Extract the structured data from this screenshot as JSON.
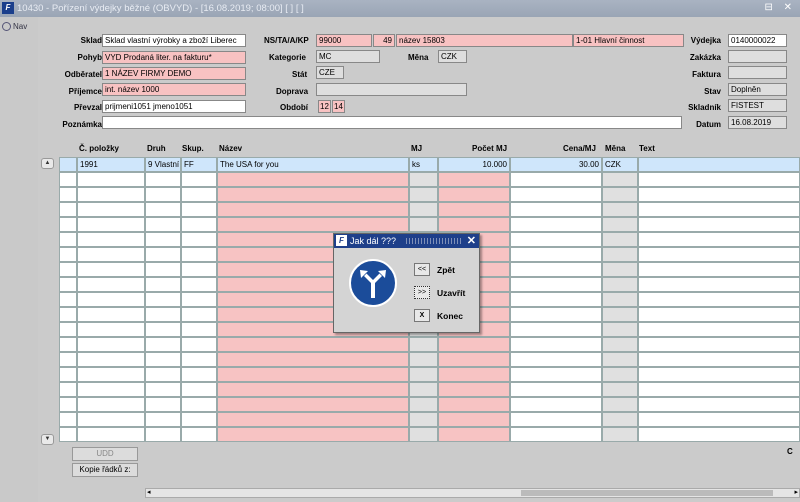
{
  "window": {
    "title": "10430 - Pořízení výdejky běžné (OBVYD) - [16.08.2019; 08:00]  [ ]  [ ]",
    "app_icon": "F",
    "controls": "⊟ ✕"
  },
  "nav": {
    "label": "Nav"
  },
  "form": {
    "sklad": {
      "label": "Sklad",
      "value": "Sklad vlastní výrobky a zboží Liberec"
    },
    "ns": {
      "label": "NS/TA/A/KP",
      "value1": "99000",
      "value2": "49",
      "value3": "název 15803",
      "value4": "1-01 Hlavní činnost"
    },
    "vydejka": {
      "label": "Výdejka",
      "value": "0140000022"
    },
    "pohyb": {
      "label": "Pohyb",
      "value": "VYD Prodaná liter. na fakturu*"
    },
    "kategorie": {
      "label": "Kategorie",
      "value": "MC"
    },
    "mena": {
      "label": "Měna",
      "value": "CZK"
    },
    "zakazka": {
      "label": "Zakázka",
      "value": ""
    },
    "odberatel": {
      "label": "Odběratel",
      "value": "1 NÁZEV FIRMY DEMO"
    },
    "stat": {
      "label": "Stát",
      "value": "CZE"
    },
    "faktura": {
      "label": "Faktura",
      "value": ""
    },
    "prijemce": {
      "label": "Příjemce",
      "value": "int. název 1000"
    },
    "doprava": {
      "label": "Doprava",
      "value": ""
    },
    "stav": {
      "label": "Stav",
      "value": "Doplněn"
    },
    "prevzal": {
      "label": "Převzal",
      "value": "prijmeni1051 jmeno1051"
    },
    "obdobi": {
      "label": "Období",
      "value1": "12",
      "value2": "14"
    },
    "skladnik": {
      "label": "Skladník",
      "value": "FISTEST"
    },
    "poznamka": {
      "label": "Poznámka",
      "value": ""
    },
    "datum": {
      "label": "Datum",
      "value": "16.08.2019"
    }
  },
  "grid": {
    "headers": {
      "polozky": "Č. položky",
      "druh": "Druh",
      "skup": "Skup.",
      "nazev": "Název",
      "mj": "MJ",
      "pocet": "Počet MJ",
      "cena": "Cena/MJ",
      "mena": "Měna",
      "text": "Text"
    },
    "rows": [
      {
        "polozky": "1991",
        "druh": "9 Vlastní",
        "skup": "FF",
        "nazev": "The USA for you",
        "mj": "ks",
        "pocet": "10.000",
        "cena": "30.00",
        "mena": "CZK",
        "text": ""
      }
    ]
  },
  "buttons": {
    "udd": "UDD",
    "kopie": "Kopie řádků z:"
  },
  "right_marker": "C",
  "dialog": {
    "title": "Jak dál ???",
    "options": [
      {
        "key": "<<",
        "label": "Zpět"
      },
      {
        "key": ">>",
        "label": "Uzavřít"
      },
      {
        "key": "X",
        "label": "Konec"
      }
    ]
  },
  "colors": {
    "required": "#f8c2c2",
    "selected_row": "#cfe6fb",
    "dialog_title": "#1e3f8a",
    "sign": "#1b4c9a"
  }
}
